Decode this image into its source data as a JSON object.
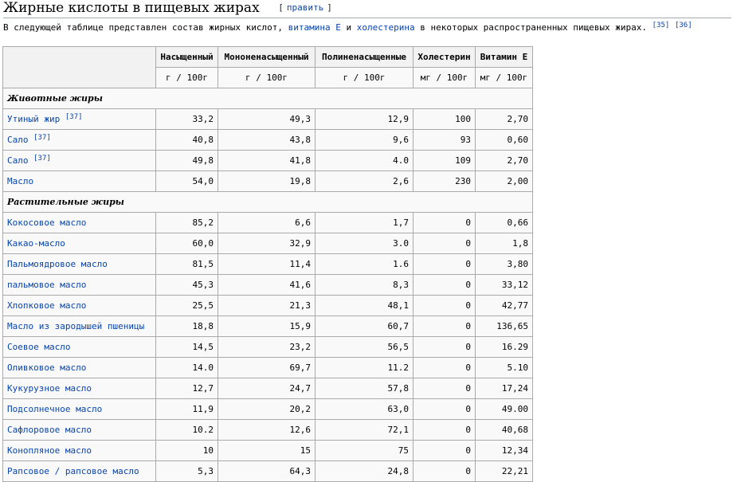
{
  "heading": {
    "title": "Жирные кислоты в пищевых жирах",
    "edit_label": "править"
  },
  "intro": {
    "text1": "В следующей таблице представлен состав жирных кислот, ",
    "link1": "витамина Е",
    "text2": " и ",
    "link2": "холестерина",
    "text3": " в некоторых распространенных пищевых жирах.",
    "ref1": "[35]",
    "ref2": "[36]"
  },
  "table": {
    "headers": [
      "Насыщенный",
      "Мононенасыщенный",
      "Полиненасыщенные",
      "Холестерин",
      "Витамин Е"
    ],
    "units": [
      "г / 100г",
      "г / 100г",
      "г / 100г",
      "мг / 100г",
      "мг / 100г"
    ],
    "sections": [
      {
        "title": "Животные жиры",
        "rows": [
          {
            "name": "Утиный жир",
            "ref": "[37]",
            "values": [
              "33,2",
              "49,3",
              "12,9",
              "100",
              "2,70"
            ]
          },
          {
            "name": "Сало",
            "ref": "[37]",
            "values": [
              "40,8",
              "43,8",
              "9,6",
              "93",
              "0,60"
            ]
          },
          {
            "name": "Сало",
            "ref": "[37]",
            "values": [
              "49,8",
              "41,8",
              "4.0",
              "109",
              "2,70"
            ]
          },
          {
            "name": "Масло",
            "ref": "",
            "values": [
              "54,0",
              "19,8",
              "2,6",
              "230",
              "2,00"
            ]
          }
        ]
      },
      {
        "title": "Растительные жиры",
        "rows": [
          {
            "name": "Кокосовое масло",
            "ref": "",
            "values": [
              "85,2",
              "6,6",
              "1,7",
              "0",
              "0,66"
            ]
          },
          {
            "name": "Какао-масло",
            "ref": "",
            "values": [
              "60,0",
              "32,9",
              "3.0",
              "0",
              "1,8"
            ]
          },
          {
            "name": "Пальмоядровое масло",
            "ref": "",
            "values": [
              "81,5",
              "11,4",
              "1.6",
              "0",
              "3,80"
            ]
          },
          {
            "name": "пальмовое масло",
            "ref": "",
            "values": [
              "45,3",
              "41,6",
              "8,3",
              "0",
              "33,12"
            ]
          },
          {
            "name": "Хлопковое масло",
            "ref": "",
            "values": [
              "25,5",
              "21,3",
              "48,1",
              "0",
              "42,77"
            ]
          },
          {
            "name": "Масло из зародышей пшеницы",
            "ref": "",
            "values": [
              "18,8",
              "15,9",
              "60,7",
              "0",
              "136,65"
            ]
          },
          {
            "name": "Соевое масло",
            "ref": "",
            "values": [
              "14,5",
              "23,2",
              "56,5",
              "0",
              "16.29"
            ]
          },
          {
            "name": "Оливковое масло",
            "ref": "",
            "values": [
              "14.0",
              "69,7",
              "11.2",
              "0",
              "5.10"
            ]
          },
          {
            "name": "Кукурузное масло",
            "ref": "",
            "values": [
              "12,7",
              "24,7",
              "57,8",
              "0",
              "17,24"
            ]
          },
          {
            "name": "Подсолнечное масло",
            "ref": "",
            "values": [
              "11,9",
              "20,2",
              "63,0",
              "0",
              "49.00"
            ]
          },
          {
            "name": "Сафлоровое масло",
            "ref": "",
            "values": [
              "10.2",
              "12,6",
              "72,1",
              "0",
              "40,68"
            ]
          },
          {
            "name": "Конопляное масло",
            "ref": "",
            "values": [
              "10",
              "15",
              "75",
              "0",
              "12,34"
            ]
          },
          {
            "name": "Рапсовое / рапсовое масло",
            "ref": "",
            "values": [
              "5,3",
              "64,3",
              "24,8",
              "0",
              "22,21"
            ]
          }
        ]
      }
    ]
  }
}
